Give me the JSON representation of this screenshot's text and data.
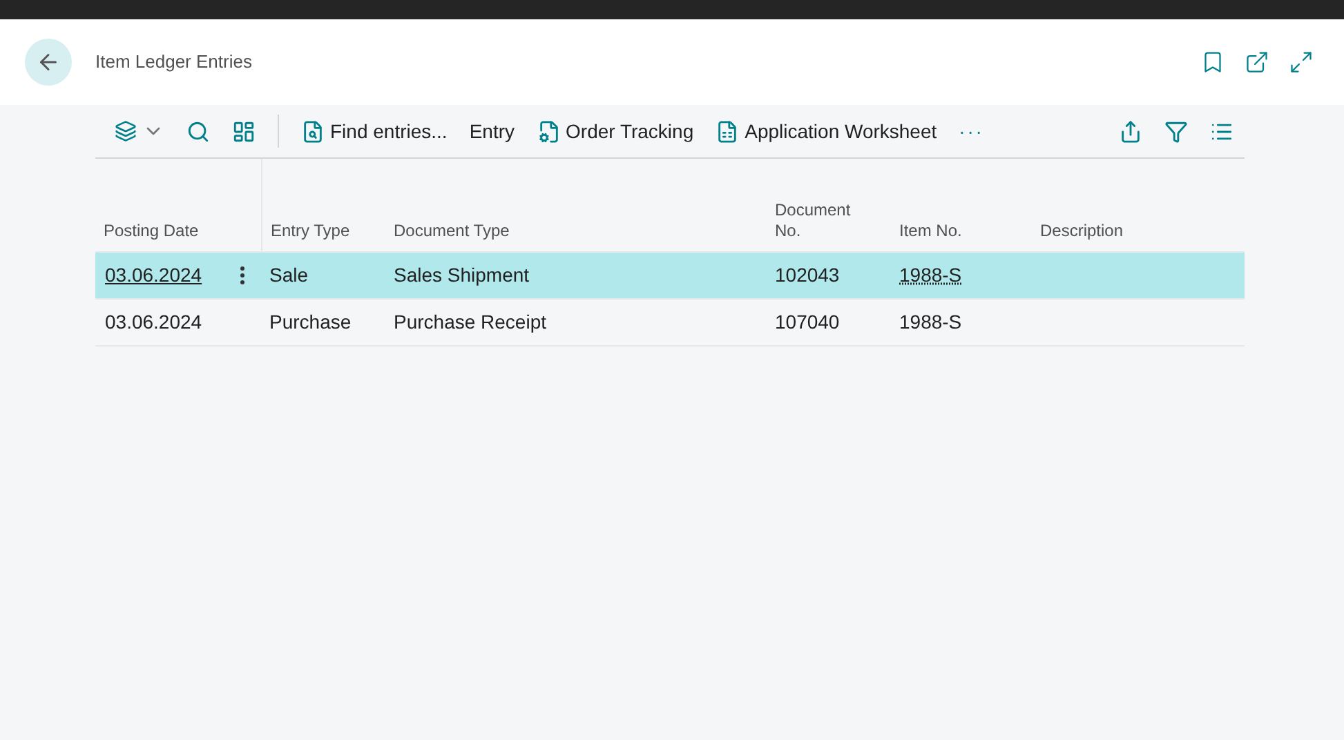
{
  "page": {
    "title": "Item Ledger Entries"
  },
  "toolbar": {
    "actions": [
      {
        "kind": "icon-menu"
      },
      {
        "kind": "search"
      },
      {
        "kind": "layout"
      },
      {
        "kind": "find",
        "label": "Find entries..."
      },
      {
        "kind": "text",
        "label": "Entry"
      },
      {
        "kind": "tracking",
        "label": "Order Tracking"
      },
      {
        "kind": "worksheet",
        "label": "Application Worksheet"
      },
      {
        "kind": "more",
        "label": "···"
      }
    ]
  },
  "table": {
    "columns": [
      {
        "label": "Posting Date"
      },
      {
        "label": "Entry Type"
      },
      {
        "label": "Document Type"
      },
      {
        "label": "Document No."
      },
      {
        "label": "Item No."
      },
      {
        "label": "Description"
      }
    ],
    "rows": [
      {
        "selected": true,
        "posting_date": "03.06.2024",
        "entry_type": "Sale",
        "document_type": "Sales Shipment",
        "document_no": "102043",
        "item_no": "1988-S"
      },
      {
        "selected": false,
        "posting_date": "03.06.2024",
        "entry_type": "Purchase",
        "document_type": "Purchase Receipt",
        "document_no": "107040",
        "item_no": "1988-S"
      }
    ]
  }
}
